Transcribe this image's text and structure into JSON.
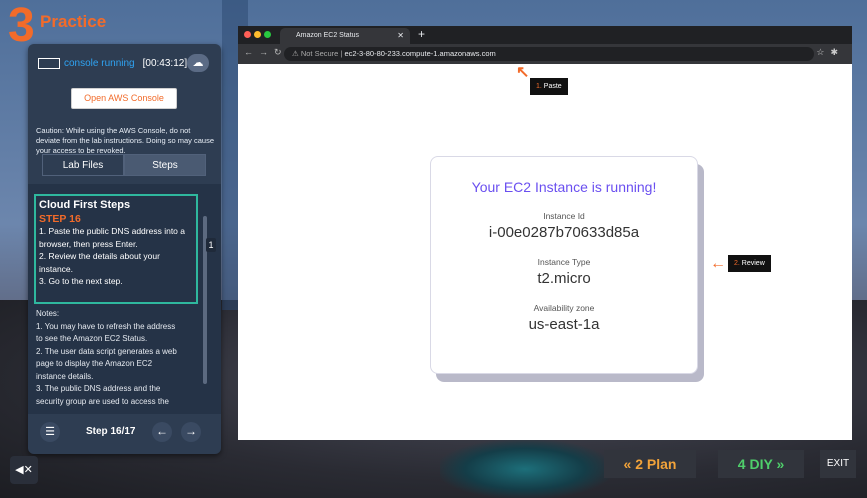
{
  "practice": {
    "number": "3",
    "title": "Practice"
  },
  "status": {
    "text": "console running",
    "timer": "[00:43:12]"
  },
  "open_console_label": "Open AWS Console",
  "caution_text": "Caution: While using the AWS Console, do not deviate from the lab instructions. Doing so may cause your access to be revoked.",
  "tabs": [
    {
      "label": "Lab Files"
    },
    {
      "label": "Steps"
    }
  ],
  "step": {
    "heading": "Cloud First Steps",
    "number": "STEP 16",
    "lines": [
      "1. Paste the public DNS address into a",
      "browser, then press Enter.",
      "2. Review the details about your",
      "instance.",
      "3. Go to the next step."
    ]
  },
  "notes": [
    "Notes:",
    "1. You may have to refresh the address",
    "to see the Amazon EC2 Status.",
    "2. The user data script generates a web",
    "page to display the Amazon EC2",
    "instance details.",
    "3. The public DNS address and the",
    "security group are used to access the"
  ],
  "step_counter": "Step 16/17",
  "side_badge": "1",
  "browser": {
    "tab_title": "Amazon EC2 Status",
    "url_prefix": "Not Secure",
    "url": "ec2-3-80-80-233.compute-1.amazonaws.com"
  },
  "card": {
    "title": "Your EC2 Instance is running!",
    "fields": [
      {
        "label": "Instance Id",
        "value": "i-00e0287b70633d85a"
      },
      {
        "label": "Instance Type",
        "value": "t2.micro"
      },
      {
        "label": "Availability zone",
        "value": "us-east-1a"
      }
    ]
  },
  "annotations": {
    "paste": {
      "num": "1.",
      "text": "Paste"
    },
    "review": {
      "num": "2.",
      "text": "Review"
    }
  },
  "bottom_nav": {
    "plan": {
      "num": "2",
      "label": "Plan"
    },
    "diy": {
      "num": "4",
      "label": "DIY"
    },
    "exit": "EXIT"
  },
  "colors": {
    "accent": "#f26b2a",
    "teal": "#2fb89e",
    "card_title": "#6a4ff0",
    "panel": "#2e3d52"
  },
  "icons": [
    "console-icon",
    "cloud-icon",
    "cursor-icon",
    "list-icon",
    "arrow-left-icon",
    "arrow-right-icon",
    "mute-icon",
    "lock-icon",
    "star-icon",
    "puzzle-icon",
    "reload-icon"
  ]
}
